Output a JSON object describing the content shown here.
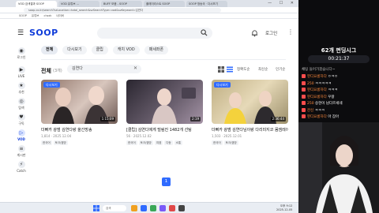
{
  "browser": {
    "tabs": [
      "VOD 검색결과 SOOP",
      "VOD 유튜브 ...",
      "BUFF 모음 - SOOP",
      "플레이리스트 SOOP",
      "SOOP 방송국 · 다시보기"
    ],
    "url": "soop.co.kr/search?szLocation=total_search&szSearchType=vod&szKeyword=김연다",
    "bookmarks": [
      "SOOP",
      "유튜브",
      "chzzk",
      "네이버"
    ],
    "window_controls": "— ☐ ✕"
  },
  "header": {
    "logo": "SOOP",
    "login_label": "로그인"
  },
  "sidebar": {
    "items": [
      {
        "label": "로그인",
        "icon": "user-icon",
        "glyph": "◉"
      },
      {
        "label": "LIVE",
        "icon": "live-icon",
        "glyph": "▶"
      },
      {
        "label": "추천",
        "icon": "star-icon",
        "glyph": "★"
      },
      {
        "label": "탐색",
        "icon": "compass-icon",
        "glyph": "◎"
      },
      {
        "label": "구독",
        "icon": "heart-icon",
        "glyph": "♥"
      },
      {
        "label": "VOD",
        "icon": "vod-icon",
        "glyph": "▷"
      },
      {
        "label": "게시판",
        "icon": "board-icon",
        "glyph": "≡"
      },
      {
        "label": "Catch",
        "icon": "catch-icon",
        "glyph": "⚡"
      }
    ]
  },
  "filters": {
    "chips": [
      "전체",
      "다시보기",
      "클립",
      "캐치 VOD",
      "패세좌폰"
    ]
  },
  "results": {
    "title": "전체",
    "count": "(3개)",
    "query": "김연다",
    "sort_options": [
      "정확도순",
      "최신순",
      "인기순"
    ]
  },
  "cards": [
    {
      "badge": "다시보기",
      "duration": "1:15:09",
      "title": "더뻐카 광범 김연다랑 올간방송",
      "meta": "1,814 · 2025.12.04",
      "tags": [
        "한국어",
        "토크/캠방"
      ],
      "thumb_colors": [
        "#b89a8c",
        "#d8c6bd"
      ]
    },
    {
      "badge": "",
      "duration": "2:19",
      "title": "[클립] 김연다에게 털림진 1482개 선팅",
      "meta": "56 · 2025.12.02",
      "tags": [
        "한국어",
        "토크/캠방",
        "여캠",
        "다등",
        "소통"
      ],
      "thumb_colors": [
        "#3a3540",
        "#9e8f9c"
      ]
    },
    {
      "badge": "다시보기",
      "duration": "2:36:44",
      "title": "더뻐카 광범 김연다님이랑 다리미지코 몸엠레이트면서",
      "meta": "1,503 · 2025.12.01",
      "tags": [
        "한국어",
        "토크/캠방"
      ],
      "thumb_colors": [
        "#c9b98a",
        "#e6d9b8"
      ]
    }
  ],
  "pagination": {
    "current": "1"
  },
  "taskbar": {
    "search_placeholder": "검색",
    "clock_time": "오후 9:12",
    "clock_date": "2025-12-05"
  },
  "overlay": {
    "title": "62개 펀딩시그",
    "timer": "00:21:37",
    "notice": "채팅 들어가겠습니다~",
    "chat": [
      {
        "badge_color": "#ff4d4d",
        "nick": "펀디요롱하다",
        "msg": "ㅇㅋㅇ"
      },
      {
        "badge_color": "#ff4d4d",
        "nick": "250",
        "msg": "ㅋㅋㅋㅋㅋ"
      },
      {
        "badge_color": "#ff4d4d",
        "nick": "펀디요롱하다",
        "msg": "ㅋㅋㅋ"
      },
      {
        "badge_color": "#ff4d4d",
        "nick": "펀디요롱하다",
        "msg": "우왕"
      },
      {
        "badge_color": "#ff4d4d",
        "nick": "250",
        "msg": "승현이 남다르세네"
      },
      {
        "badge_color": "#ff4d4d",
        "nick": "잔신",
        "msg": "ㅋㅋㅋ"
      },
      {
        "badge_color": "#ff4d4d",
        "nick": "펀디요롱하다",
        "msg": "아 잠아"
      }
    ]
  },
  "colors": {
    "brand": "#0e3bd9",
    "accent": "#2f6bff",
    "chat_nick": "#ff8a3d"
  }
}
